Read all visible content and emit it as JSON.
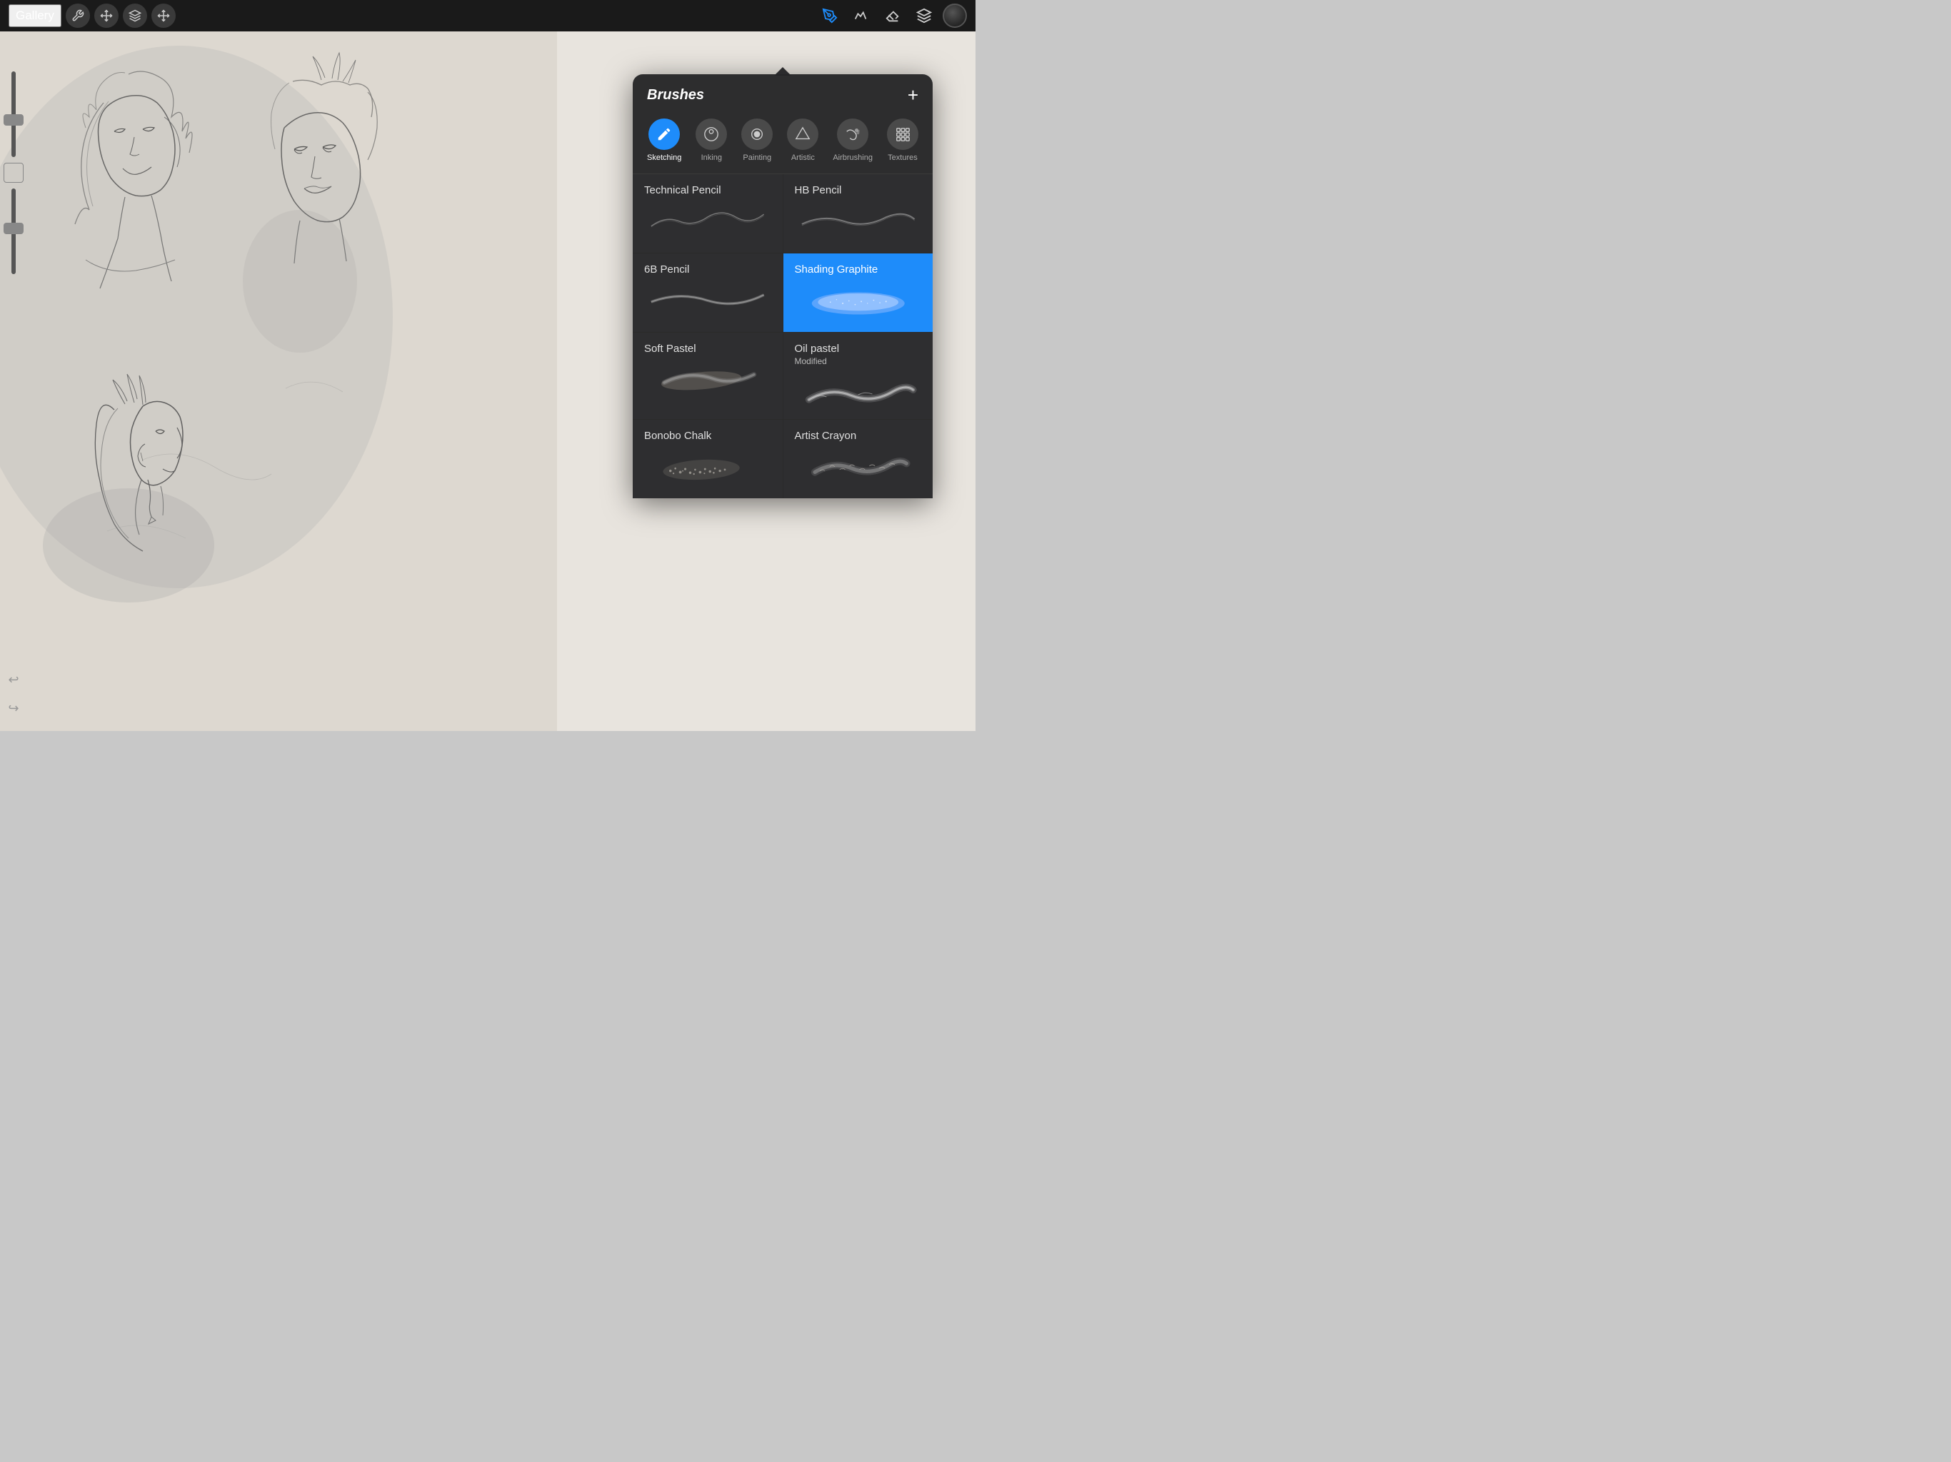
{
  "topbar": {
    "gallery_label": "Gallery",
    "tools": [
      {
        "name": "wrench-icon",
        "symbol": "⚙"
      },
      {
        "name": "transform-icon",
        "symbol": "↗"
      },
      {
        "name": "select-icon",
        "symbol": "S"
      },
      {
        "name": "move-icon",
        "symbol": "✦"
      }
    ],
    "right_tools": [
      {
        "name": "pencil-tool",
        "symbol": "✏",
        "active": true
      },
      {
        "name": "smudge-tool",
        "symbol": "✒"
      },
      {
        "name": "eraser-tool",
        "symbol": "◫"
      },
      {
        "name": "layers-tool",
        "symbol": "⧉"
      }
    ]
  },
  "brushes_panel": {
    "title": "Brushes",
    "add_btn": "+",
    "categories": [
      {
        "id": "sketching",
        "label": "Sketching",
        "icon": "✏",
        "active": true
      },
      {
        "id": "inking",
        "label": "Inking",
        "icon": "◉"
      },
      {
        "id": "painting",
        "label": "Painting",
        "icon": "●"
      },
      {
        "id": "artistic",
        "label": "Artistic",
        "icon": "▲"
      },
      {
        "id": "airbrushing",
        "label": "Airbrushing",
        "icon": "≋"
      },
      {
        "id": "textures",
        "label": "Textures",
        "icon": "⋮⋮"
      }
    ],
    "brushes": [
      {
        "name": "Technical Pencil",
        "modified": null,
        "selected": false,
        "stroke_type": "thin_wave"
      },
      {
        "name": "HB Pencil",
        "modified": null,
        "selected": false,
        "stroke_type": "thin_wave2"
      },
      {
        "name": "6B Pencil",
        "modified": null,
        "selected": false,
        "stroke_type": "thick_wave"
      },
      {
        "name": "Shading Graphite",
        "modified": null,
        "selected": true,
        "stroke_type": "shading"
      },
      {
        "name": "Soft Pastel",
        "modified": null,
        "selected": false,
        "stroke_type": "pastel"
      },
      {
        "name": "Oil pastel",
        "modified": "Modified",
        "selected": false,
        "stroke_type": "oil"
      },
      {
        "name": "Bonobo Chalk",
        "modified": null,
        "selected": false,
        "stroke_type": "chalk"
      },
      {
        "name": "Artist Crayon",
        "modified": null,
        "selected": false,
        "stroke_type": "crayon"
      }
    ]
  },
  "sidebar": {
    "undo_label": "↩",
    "redo_label": "↪"
  }
}
